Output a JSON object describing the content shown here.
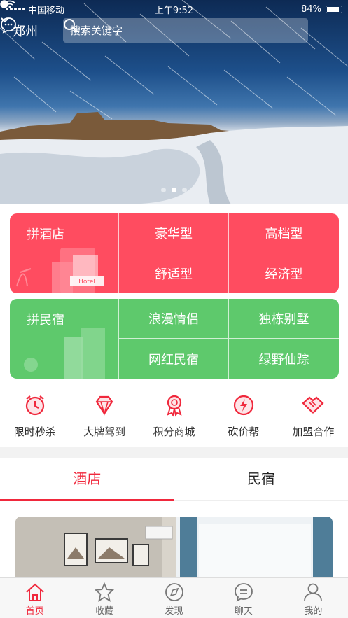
{
  "status_bar": {
    "carrier": "中国移动",
    "time": "上午9:52",
    "battery": "84%",
    "battery_level": 0.84
  },
  "header": {
    "city": "郑州",
    "search_placeholder": "搜索关键字"
  },
  "banner": {
    "dots": 3,
    "active_dot": 1
  },
  "hotel_block": {
    "title": "拼酒店",
    "sign": "Hotel",
    "options": [
      "豪华型",
      "高档型",
      "舒适型",
      "经济型"
    ]
  },
  "bnb_block": {
    "title": "拼民宿",
    "options": [
      "浪漫情侣",
      "独栋别墅",
      "网红民宿",
      "绿野仙踪"
    ]
  },
  "quick_links": [
    {
      "label": "限时秒杀",
      "icon": "alarm-clock-icon"
    },
    {
      "label": "大牌驾到",
      "icon": "diamond-icon"
    },
    {
      "label": "积分商城",
      "icon": "medal-icon"
    },
    {
      "label": "砍价帮",
      "icon": "lightning-icon"
    },
    {
      "label": "加盟合作",
      "icon": "handshake-icon"
    }
  ],
  "tabs": [
    {
      "label": "酒店",
      "active": true
    },
    {
      "label": "民宿",
      "active": false
    }
  ],
  "bottom_nav": [
    {
      "label": "首页",
      "icon": "home-icon",
      "active": true
    },
    {
      "label": "收藏",
      "icon": "star-icon",
      "active": false
    },
    {
      "label": "发现",
      "icon": "compass-icon",
      "active": false
    },
    {
      "label": "聊天",
      "icon": "chat-icon",
      "active": false
    },
    {
      "label": "我的",
      "icon": "user-icon",
      "active": false
    }
  ],
  "colors": {
    "accent": "#f0283c",
    "hotel": "#ff4c60",
    "bnb": "#5ec96c"
  }
}
